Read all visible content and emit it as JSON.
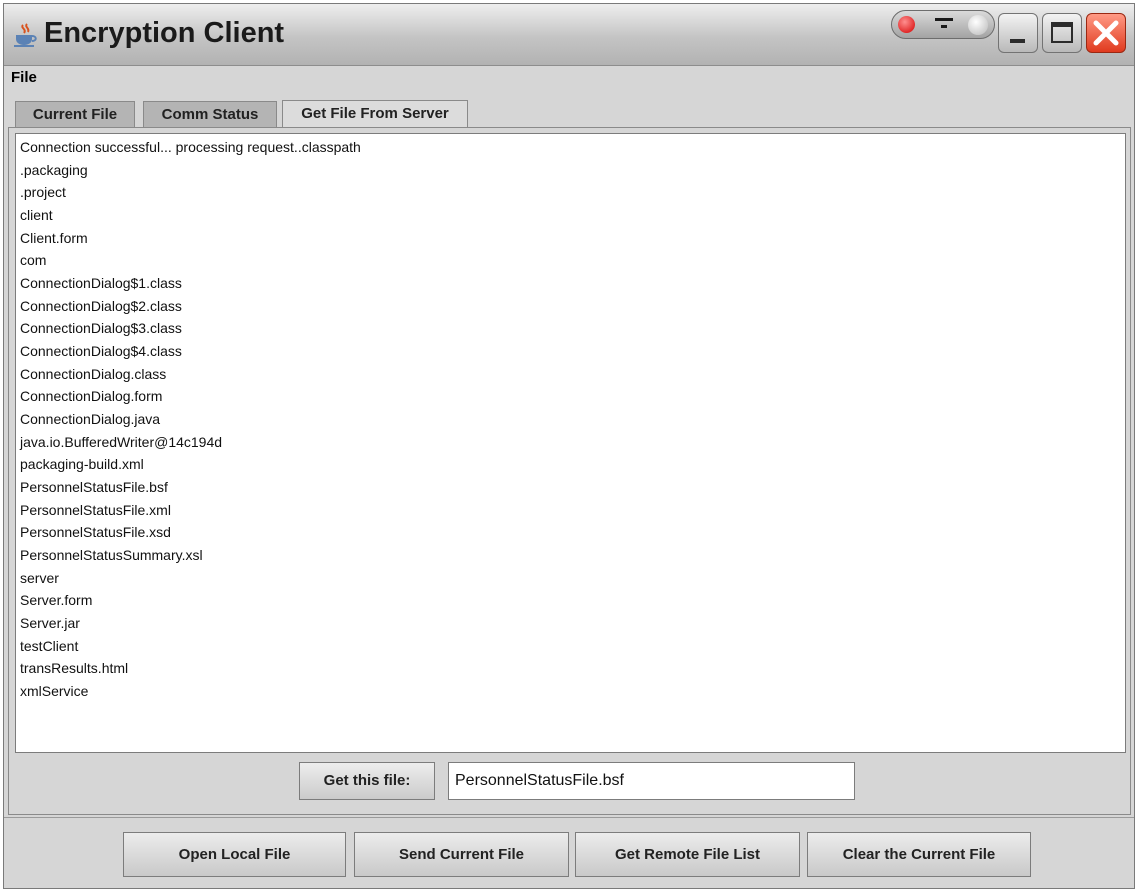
{
  "window": {
    "title": "Encryption Client"
  },
  "menu": {
    "file": "File"
  },
  "tabs": [
    {
      "label": "Current File",
      "active": false
    },
    {
      "label": "Comm Status",
      "active": false
    },
    {
      "label": "Get File From Server",
      "active": true
    }
  ],
  "output": {
    "lines": [
      "Connection successful... processing request..classpath",
      ".packaging",
      ".project",
      "client",
      "Client.form",
      "com",
      "ConnectionDialog$1.class",
      "ConnectionDialog$2.class",
      "ConnectionDialog$3.class",
      "ConnectionDialog$4.class",
      "ConnectionDialog.class",
      "ConnectionDialog.form",
      "ConnectionDialog.java",
      "java.io.BufferedWriter@14c194d",
      "packaging-build.xml",
      "PersonnelStatusFile.bsf",
      "PersonnelStatusFile.xml",
      "PersonnelStatusFile.xsd",
      "PersonnelStatusSummary.xsl",
      "server",
      "Server.form",
      "Server.jar",
      "testClient",
      "transResults.html",
      "xmlService"
    ]
  },
  "get_file": {
    "button_label": "Get this file:",
    "input_value": "PersonnelStatusFile.bsf"
  },
  "actions": {
    "open_local": "Open Local File",
    "send_current": "Send Current File",
    "get_remote_list": "Get Remote File List",
    "clear_current": "Clear the Current File"
  },
  "icons": {
    "app": "java-cup-icon",
    "minimize": "minimize-icon",
    "maximize": "maximize-icon",
    "close": "close-icon"
  },
  "colors": {
    "close_button": "#e03a1e",
    "window_bg": "#d6d6d6"
  }
}
